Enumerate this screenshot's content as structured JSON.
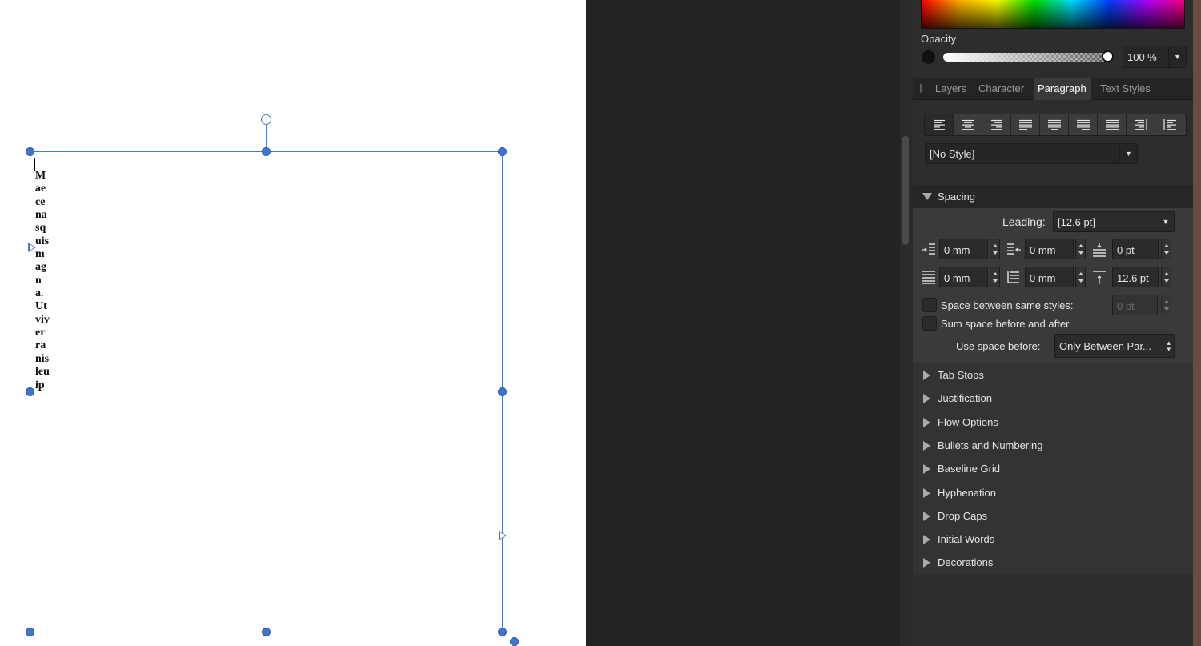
{
  "canvas": {
    "vertical_text": "Maecenasquismagna.Utviverranisleuip"
  },
  "color_panel": {
    "opacity_label": "Opacity",
    "opacity_value": "100 %",
    "opacity_percent": 100
  },
  "tabs": [
    {
      "label": "Layers",
      "active": false
    },
    {
      "label": "Character",
      "active": false
    },
    {
      "label": "Paragraph",
      "active": true
    },
    {
      "label": "Text Styles",
      "active": false
    }
  ],
  "alignment_buttons": [
    {
      "icon": "align-left-icon",
      "active": true
    },
    {
      "icon": "align-center-icon",
      "active": false
    },
    {
      "icon": "align-right-icon",
      "active": false
    },
    {
      "icon": "justify-left-icon",
      "active": false
    },
    {
      "icon": "justify-center-icon",
      "active": false
    },
    {
      "icon": "justify-right-icon",
      "active": false
    },
    {
      "icon": "justify-all-icon",
      "active": false
    },
    {
      "icon": "align-towards-spine-icon",
      "active": false
    },
    {
      "icon": "align-away-from-spine-icon",
      "active": false
    }
  ],
  "paragraph_style": "[No Style]",
  "spacing": {
    "title": "Spacing",
    "leading_label": "Leading:",
    "leading_value": "[12.6 pt]",
    "left_indent": "0 mm",
    "right_indent": "0 mm",
    "space_before": "0 pt",
    "first_line_indent": "0 mm",
    "last_line_indent": "0 mm",
    "space_after": "12.6 pt",
    "space_between_same_styles_label": "Space between same styles:",
    "space_between_same_styles_value": "0 pt",
    "sum_space_label": "Sum space before and after",
    "use_space_before_label": "Use space before:",
    "use_space_before_value": "Only Between Par..."
  },
  "sections": [
    "Tab Stops",
    "Justification",
    "Flow Options",
    "Bullets and Numbering",
    "Baseline Grid",
    "Hyphenation",
    "Drop Caps",
    "Initial Words",
    "Decorations"
  ]
}
